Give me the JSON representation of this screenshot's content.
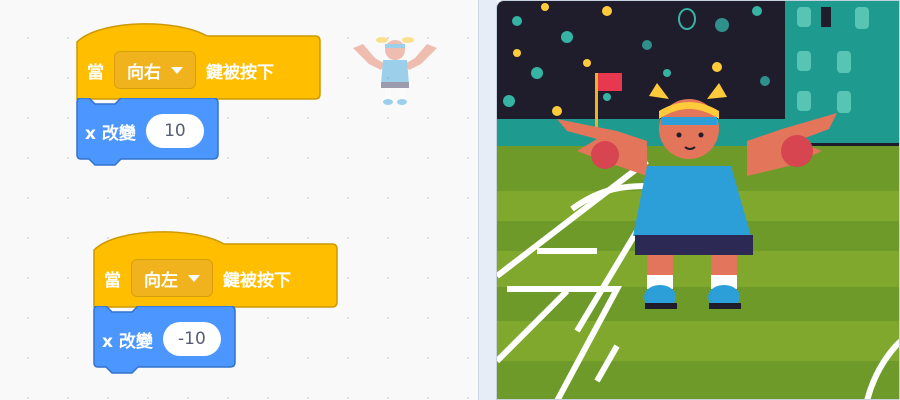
{
  "scripts": [
    {
      "hat": {
        "prefix": "當",
        "key": "向右",
        "suffix": "鍵被按下"
      },
      "motion": {
        "label": "x 改變",
        "value": "10"
      }
    },
    {
      "hat": {
        "prefix": "當",
        "key": "向左",
        "suffix": "鍵被按下"
      },
      "motion": {
        "label": "x 改變",
        "value": "-10"
      }
    }
  ],
  "icons": {
    "sprite_thumbnail": "sprite-icon",
    "dropdown": "chevron-down-icon",
    "flag": "flag-icon"
  },
  "colors": {
    "event_block": "#FFBF00",
    "event_border": "#CC9900",
    "motion_block": "#4C97FF",
    "motion_border": "#3373CC",
    "stage_sky": "#1d1d2b",
    "stage_grass": "#7fa82c",
    "character_shirt": "#2d9fd8",
    "character_skin": "#e2755a"
  }
}
